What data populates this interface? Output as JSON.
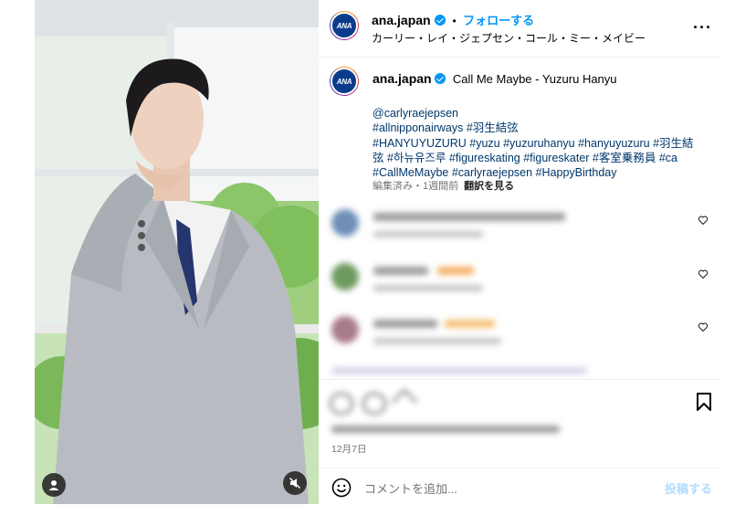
{
  "post": {
    "username": "ana.japan",
    "follow_separator": "•",
    "follow_label": "フォローする",
    "audio_label": "カーリー・レイ・ジェプセン・コール・ミー・メイビー",
    "avatar_text": "ANA",
    "more_label": "···"
  },
  "caption": {
    "username": "ana.japan",
    "title": "Call Me Maybe - Yuzuru Hanyu",
    "lines": [
      "@carlyraejepsen",
      "#allnipponairways #羽生結弦",
      "#HANYUYUZURU #yuzu #yuzuruhanyu #hanyuyuzuru #羽生結",
      "弦 #하뉴유즈루 #figureskating #figureskater #客室乗務員 #ca",
      "#CallMeMaybe #carlyraejepsen #HappyBirthday"
    ],
    "edited": "編集済み・1週間前",
    "translate": "翻訳を見る"
  },
  "footer": {
    "date": "12月7日",
    "comment_placeholder": "コメントを追加...",
    "post_label": "投稿する"
  },
  "colors": {
    "accent": "#0095f6",
    "link": "#00376b",
    "ana_blue": "#0b3c8c"
  }
}
